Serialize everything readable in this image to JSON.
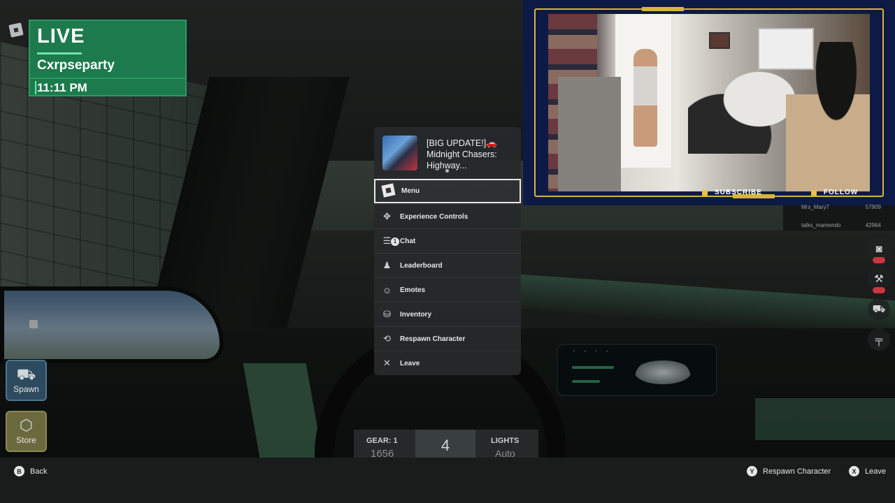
{
  "live_overlay": {
    "status": "LIVE",
    "channel": "Cxrpseparty",
    "time": "11:11 PM"
  },
  "webcam": {
    "subscribe_label": "SUBSCRIBE",
    "follow_label": "FOLLOW",
    "accent_color": "#d9b43a"
  },
  "leaderboard": {
    "rows": [
      {
        "name": "Mrs_Mary7",
        "value": "57909"
      },
      {
        "name": "talks_mamendo",
        "value": "42964"
      }
    ]
  },
  "game_menu": {
    "game_title": "[BIG UPDATE!]🚗Midnight Chasers: Highway...",
    "items": [
      {
        "label": "Menu",
        "icon": "roblox-logo-icon"
      },
      {
        "label": "Experience Controls",
        "icon": "dpad-icon"
      },
      {
        "label": "Chat",
        "icon": "chat-icon",
        "badge": "1"
      },
      {
        "label": "Leaderboard",
        "icon": "leaderboard-icon"
      },
      {
        "label": "Emotes",
        "icon": "emote-icon"
      },
      {
        "label": "Inventory",
        "icon": "backpack-icon"
      },
      {
        "label": "Respawn Character",
        "icon": "respawn-icon"
      },
      {
        "label": "Leave",
        "icon": "close-icon"
      }
    ]
  },
  "left_buttons": {
    "spawn_label": "Spawn",
    "store_label": "Store"
  },
  "hud": {
    "gear_label": "GEAR:",
    "gear_value": "1",
    "speed": "1656",
    "center_value": "4",
    "lights_label": "LIGHTS",
    "lights_value": "Auto"
  },
  "bottom_hints": {
    "back": {
      "button": "B",
      "label": "Back"
    },
    "respawn": {
      "button": "Y",
      "label": "Respawn Character"
    },
    "leave": {
      "button": "X",
      "label": "Leave"
    }
  },
  "colors": {
    "live_green": "#1d7a4c",
    "webcam_navy": "#0d1a45",
    "spawn_blue": "#2e4a5e",
    "store_olive": "#6b6a3e",
    "badge_red": "#c8373f"
  }
}
